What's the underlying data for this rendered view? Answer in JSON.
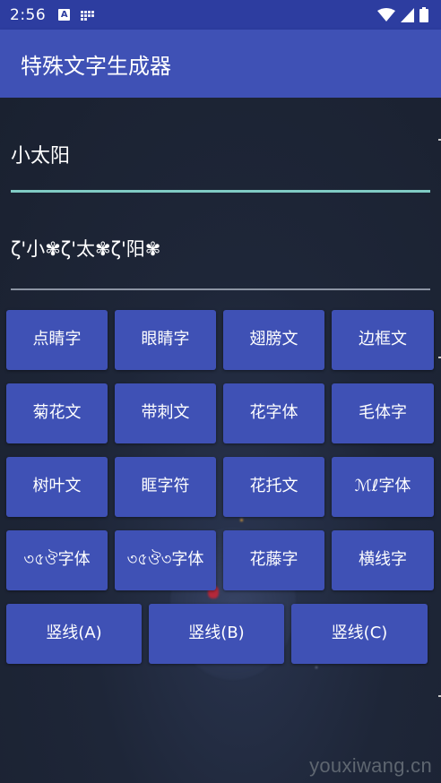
{
  "status_bar": {
    "time": "2:56",
    "a_icon": "A"
  },
  "app_bar": {
    "title": "特殊文字生成器"
  },
  "input": {
    "value": "小太阳"
  },
  "output": {
    "value": "ζ'小✾ζ'太✾ζ'阳✾"
  },
  "buttons": {
    "row1": [
      "点睛字",
      "眼睛字",
      "翅膀文",
      "边框文"
    ],
    "row2": [
      "菊花文",
      "带刺文",
      "花字体",
      "毛体字"
    ],
    "row3": [
      "树叶文",
      "眶字符",
      "花托文",
      "ℳℓ字体"
    ],
    "row4": [
      "৩৫ঔ字体",
      "৩৫ঔ৩字体",
      "花藤字",
      "横线字"
    ],
    "row5": [
      "竖线(A)",
      "竖线(B)",
      "竖线(C)"
    ]
  },
  "watermark": "youxiwang.cn",
  "colors": {
    "primary": "#3f51b5",
    "status_bar": "#2d3da0",
    "accent_line": "#80cbc4",
    "background": "#1c2433"
  }
}
